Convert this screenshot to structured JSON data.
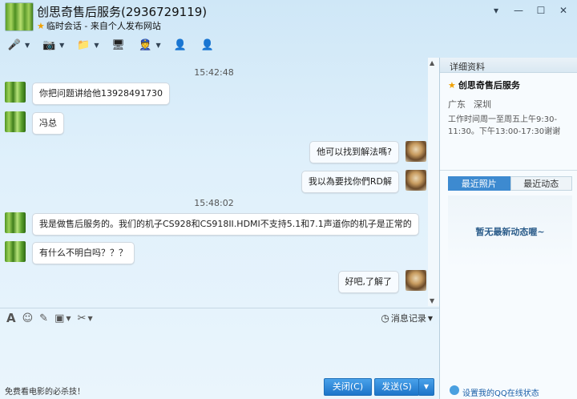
{
  "window": {
    "title": "创思奇售后服务(2936729119)",
    "subtitle": "临时会话 - 来自个人发布网站",
    "controls": [
      "▾",
      "—",
      "☐",
      "✕"
    ]
  },
  "toolbar": {
    "items": [
      {
        "name": "voice",
        "glyph": "🎤"
      },
      {
        "name": "video",
        "glyph": "📷"
      },
      {
        "name": "file",
        "glyph": "📁"
      },
      {
        "name": "screen",
        "glyph": "🖥"
      },
      {
        "name": "app",
        "glyph": "👮"
      },
      {
        "name": "remove-user",
        "glyph": "👤"
      },
      {
        "name": "add-user",
        "glyph": "👤"
      }
    ]
  },
  "chat": {
    "messages": [
      {
        "type": "time",
        "text": "15:42:48"
      },
      {
        "type": "them",
        "text": "你把问题讲给他13928491730"
      },
      {
        "type": "them",
        "text": "冯总"
      },
      {
        "type": "me",
        "text": "他可以找到解法嗎?"
      },
      {
        "type": "me",
        "text": "我以為要找你們RD解"
      },
      {
        "type": "time",
        "text": "15:48:02"
      },
      {
        "type": "them",
        "text": "我是做售后服务的。我们的机子CS928和CS918II.HDMI不支持5.1和7.1声道你的机子是正常的"
      },
      {
        "type": "them",
        "text": "有什么不明白吗？？？"
      },
      {
        "type": "me",
        "text": "好吧,了解了"
      }
    ]
  },
  "inputbar": {
    "history_label": "消息记录"
  },
  "footer": {
    "promo": "免费看电影的必杀技！",
    "close_label": "关闭(C)",
    "send_label": "发送(S)"
  },
  "panel": {
    "header": "详细资料",
    "name": "创思奇售后服务",
    "province": "广东",
    "city": "深圳",
    "hours": "工作时间周一至周五上午9:30-11:30。下午13:00-17:30谢谢",
    "tab_photos": "最近照片",
    "tab_news": "最近动态",
    "empty_text": "暂无最新动态喔~",
    "online_link": "设置我的QQ在线状态"
  }
}
